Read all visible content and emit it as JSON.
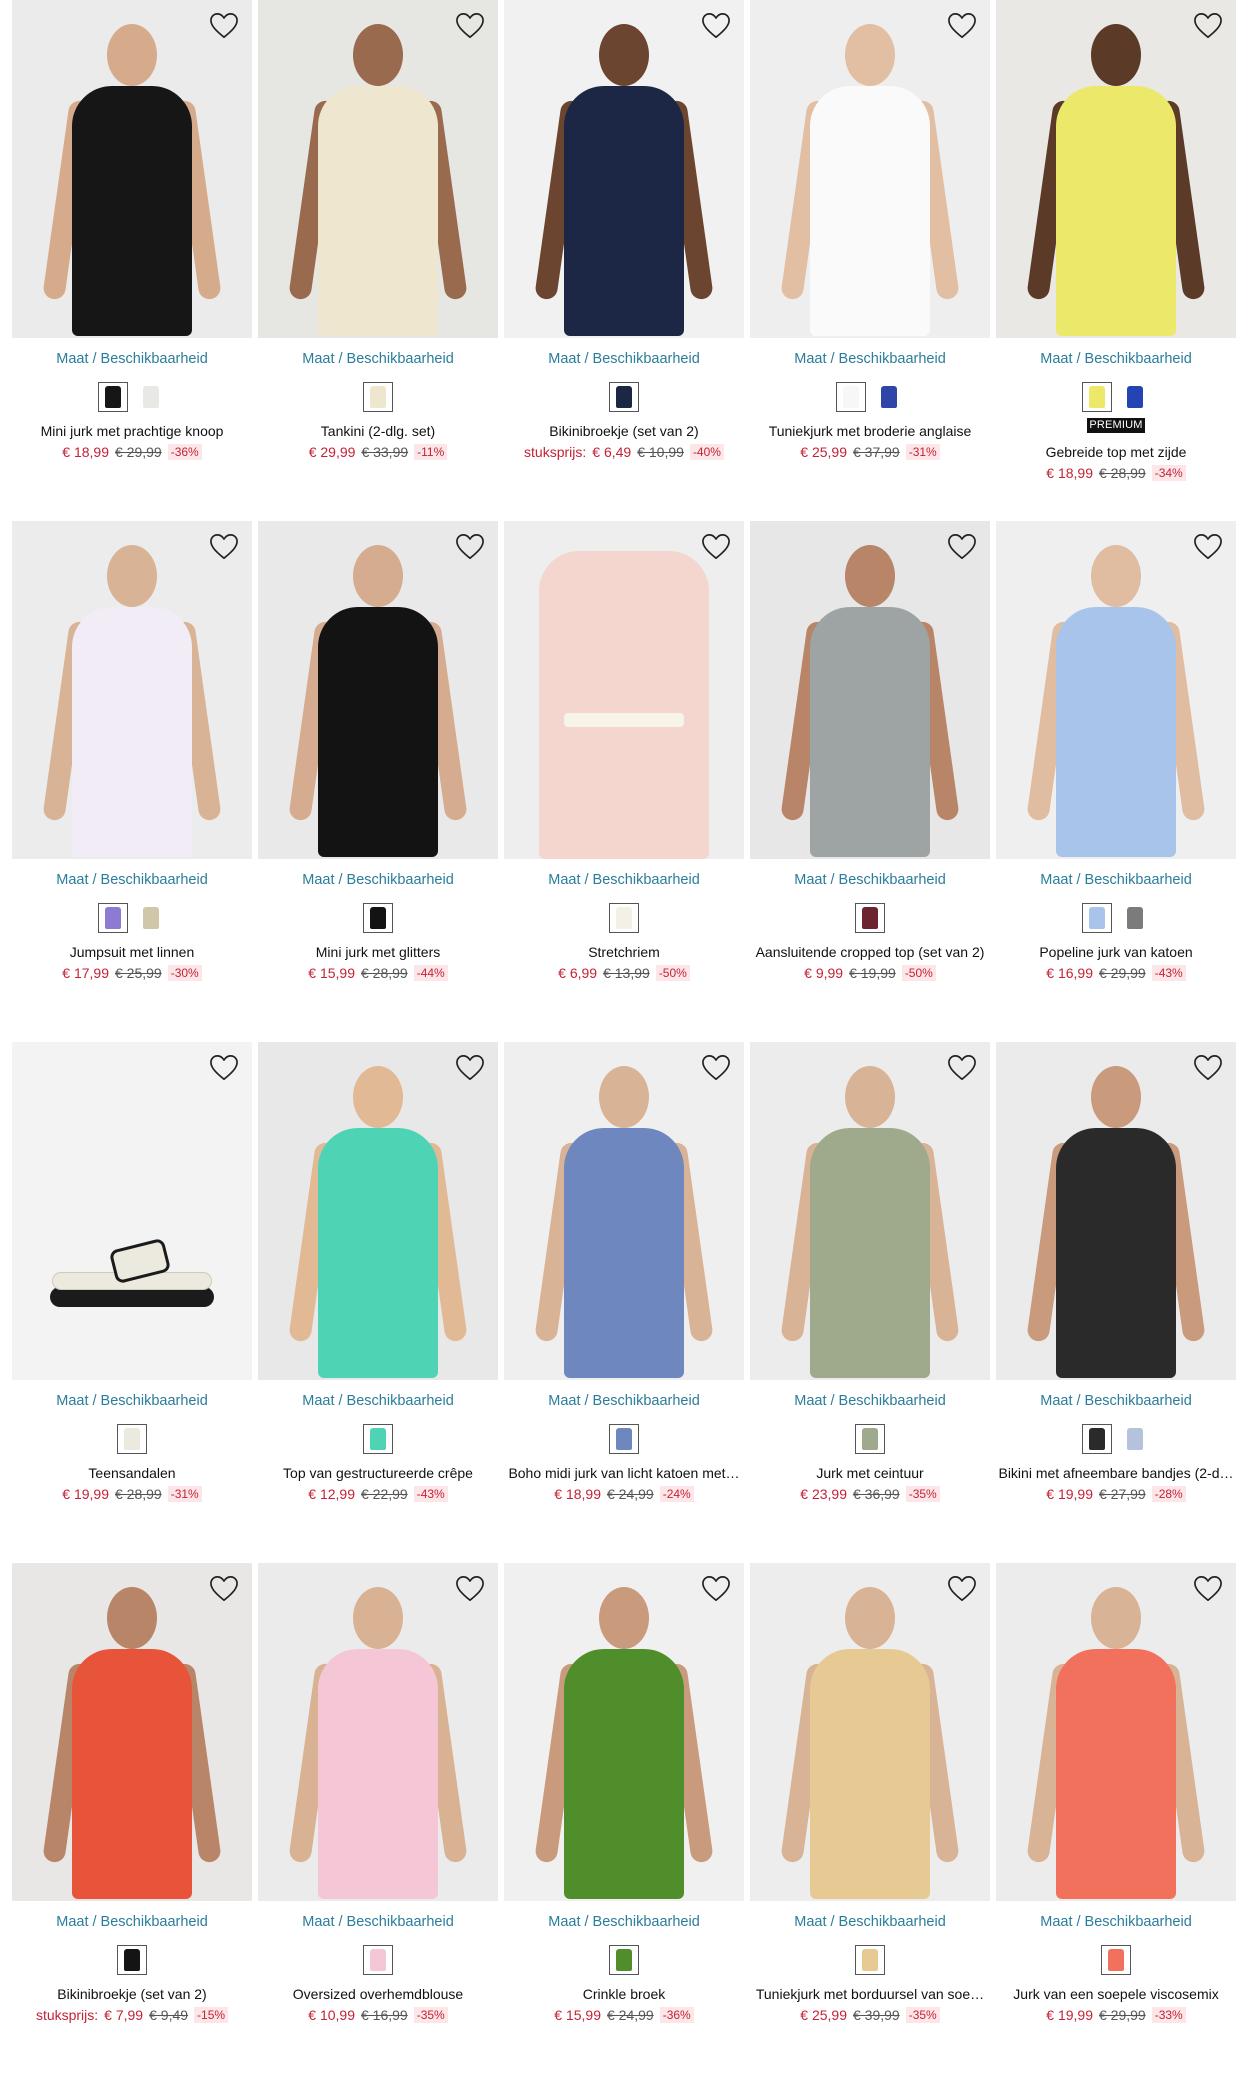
{
  "grid": {
    "size_link_label": "Maat / Beschikbaarheid",
    "wishlist_icon": "heart-outline-icon",
    "products": [
      {
        "title": "Mini jurk met prachtige knoop",
        "unit_label": "",
        "price": "€ 18,99",
        "old_price": "€ 29,99",
        "discount": "-36%",
        "premium": "",
        "bg": "#ebebeb",
        "garment": "#161616",
        "skin": "#d6ab8c",
        "shape": "person",
        "swatches": [
          "#161616",
          "#e8e8e4"
        ]
      },
      {
        "title": "Tankini (2-dlg. set)",
        "unit_label": "",
        "price": "€ 29,99",
        "old_price": "€ 33,99",
        "discount": "-11%",
        "premium": "",
        "bg": "#e6e6e3",
        "garment": "#efe6cf",
        "skin": "#9a6a4f",
        "shape": "person",
        "swatches": [
          "#efe6cf"
        ]
      },
      {
        "title": "Bikinibroekje (set van 2)",
        "unit_label": "stuksprijs:",
        "price": "€ 6,49",
        "old_price": "€ 10,99",
        "discount": "-40%",
        "premium": "",
        "bg": "#f1f1f1",
        "garment": "#1b2745",
        "skin": "#6c4530",
        "shape": "person",
        "swatches": [
          "#1b2745"
        ]
      },
      {
        "title": "Tuniekjurk met broderie anglaise",
        "unit_label": "",
        "price": "€ 25,99",
        "old_price": "€ 37,99",
        "discount": "-31%",
        "premium": "",
        "bg": "#eeeeee",
        "garment": "#fafafa",
        "skin": "#e2bfa3",
        "shape": "person",
        "swatches": [
          "#f7f7f7",
          "#2f46a8"
        ]
      },
      {
        "title": "Gebreide top met zijde",
        "unit_label": "",
        "price": "€ 18,99",
        "old_price": "€ 28,99",
        "discount": "-34%",
        "premium": "PREMIUM",
        "bg": "#eae8e4",
        "garment": "#ece86a",
        "skin": "#5b3a28",
        "shape": "person",
        "swatches": [
          "#ece86a",
          "#2544b3"
        ]
      },
      {
        "title": "Jumpsuit met linnen",
        "unit_label": "",
        "price": "€ 17,99",
        "old_price": "€ 25,99",
        "discount": "-30%",
        "premium": "",
        "bg": "#ececec",
        "garment": "#f1ecf6",
        "skin": "#d9b395",
        "shape": "person",
        "swatches": [
          "#8c7ad3",
          "#cfc7a8"
        ]
      },
      {
        "title": "Mini jurk met glitters",
        "unit_label": "",
        "price": "€ 15,99",
        "old_price": "€ 28,99",
        "discount": "-44%",
        "premium": "",
        "bg": "#e9e9e9",
        "garment": "#131313",
        "skin": "#d5ac8f",
        "shape": "person",
        "swatches": [
          "#131313"
        ]
      },
      {
        "title": "Stretchriem",
        "unit_label": "",
        "price": "€ 6,99",
        "old_price": "€ 13,99",
        "discount": "-50%",
        "premium": "",
        "bg": "#eeeeee",
        "garment": "#f4d6cf",
        "skin": "#f4d6cf",
        "shape": "blazer",
        "swatches": [
          "#f4f0e6"
        ]
      },
      {
        "title": "Aansluitende cropped top (set van 2)",
        "unit_label": "",
        "price": "€ 9,99",
        "old_price": "€ 19,99",
        "discount": "-50%",
        "premium": "",
        "bg": "#e7e7e7",
        "garment": "#9ea4a3",
        "skin": "#b98569",
        "shape": "person",
        "swatches": [
          "#6b2430"
        ]
      },
      {
        "title": "Popeline jurk van katoen",
        "unit_label": "",
        "price": "€ 16,99",
        "old_price": "€ 29,99",
        "discount": "-43%",
        "premium": "",
        "bg": "#efefef",
        "garment": "#a9c4ea",
        "skin": "#e0bca0",
        "shape": "person",
        "swatches": [
          "#a9c4ea",
          "#7b7b7b"
        ]
      },
      {
        "title": "Teensandalen",
        "unit_label": "",
        "price": "€ 19,99",
        "old_price": "€ 28,99",
        "discount": "-31%",
        "premium": "",
        "bg": "#f3f3f3",
        "garment": "#ece9df",
        "skin": "#1b1b1b",
        "shape": "sandal",
        "swatches": [
          "#ece9df"
        ]
      },
      {
        "title": "Top van gestructureerde crêpe",
        "unit_label": "",
        "price": "€ 12,99",
        "old_price": "€ 22,99",
        "discount": "-43%",
        "premium": "",
        "bg": "#e8e8e8",
        "garment": "#4fd3b5",
        "skin": "#e1b995",
        "shape": "person",
        "swatches": [
          "#4fd3b5"
        ]
      },
      {
        "title": "Boho midi jurk van licht katoen met…",
        "unit_label": "",
        "price": "€ 18,99",
        "old_price": "€ 24,99",
        "discount": "-24%",
        "premium": "",
        "bg": "#efefef",
        "garment": "#6f87bf",
        "skin": "#d9b395",
        "shape": "person",
        "swatches": [
          "#6f87bf"
        ]
      },
      {
        "title": "Jurk met ceintuur",
        "unit_label": "",
        "price": "€ 23,99",
        "old_price": "€ 36,99",
        "discount": "-35%",
        "premium": "",
        "bg": "#ececec",
        "garment": "#9fa98c",
        "skin": "#d9b395",
        "shape": "person",
        "swatches": [
          "#9fa98c"
        ]
      },
      {
        "title": "Bikini met afneembare bandjes (2-d…",
        "unit_label": "",
        "price": "€ 19,99",
        "old_price": "€ 27,99",
        "discount": "-28%",
        "premium": "",
        "bg": "#ebebeb",
        "garment": "#2a2a2a",
        "skin": "#c99a7c",
        "shape": "person",
        "swatches": [
          "#2a2a2a",
          "#b5c2dc"
        ]
      },
      {
        "title": "Bikinibroekje (set van 2)",
        "unit_label": "stuksprijs:",
        "price": "€ 7,99",
        "old_price": "€ 9,49",
        "discount": "-15%",
        "premium": "",
        "bg": "#e9e7e5",
        "garment": "#e8543a",
        "skin": "#b98569",
        "shape": "person",
        "swatches": [
          "#141414"
        ]
      },
      {
        "title": "Oversized overhemdblouse",
        "unit_label": "",
        "price": "€ 10,99",
        "old_price": "€ 16,99",
        "discount": "-35%",
        "premium": "",
        "bg": "#ebebeb",
        "garment": "#f5c7d6",
        "skin": "#d8b293",
        "shape": "person",
        "swatches": [
          "#f5c7d6"
        ]
      },
      {
        "title": "Crinkle broek",
        "unit_label": "",
        "price": "€ 15,99",
        "old_price": "€ 24,99",
        "discount": "-36%",
        "premium": "",
        "bg": "#f0f0f0",
        "garment": "#4f8e2a",
        "skin": "#c99a7c",
        "shape": "person",
        "swatches": [
          "#4f8e2a"
        ]
      },
      {
        "title": "Tuniekjurk met borduursel van soe…",
        "unit_label": "",
        "price": "€ 25,99",
        "old_price": "€ 39,99",
        "discount": "-35%",
        "premium": "",
        "bg": "#ededed",
        "garment": "#e7c993",
        "skin": "#d9b395",
        "shape": "person",
        "swatches": [
          "#e7c993"
        ]
      },
      {
        "title": "Jurk van een soepele viscosemix",
        "unit_label": "",
        "price": "€ 19,99",
        "old_price": "€ 29,99",
        "discount": "-33%",
        "premium": "",
        "bg": "#ececec",
        "garment": "#f2715d",
        "skin": "#d9b395",
        "shape": "person",
        "swatches": [
          "#f2715d"
        ]
      }
    ]
  }
}
